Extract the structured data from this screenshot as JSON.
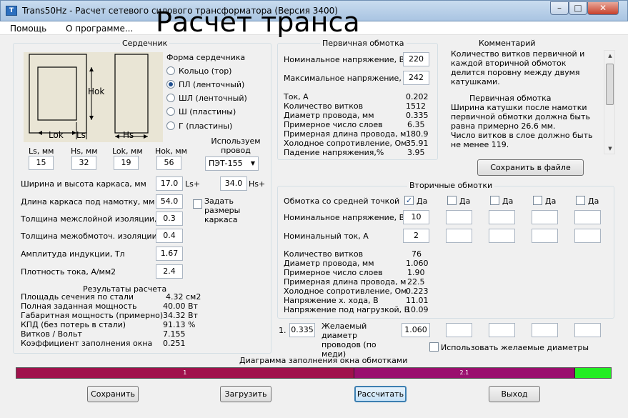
{
  "window": {
    "title": "Trans50Hz - Расчет сетевого силового трансформатора (Версия 3400)",
    "icon": "app-icon",
    "min": "–",
    "max": "□",
    "close": "✕"
  },
  "menu": {
    "help": "Помощь",
    "about": "О программе..."
  },
  "watermark": "Расчет транса",
  "core": {
    "title": "Сердечник",
    "figure_labels": {
      "hok": "Hok",
      "lok": "Lok",
      "ls": "Ls",
      "hs": "Hs"
    },
    "shape_title": "Форма сердечника",
    "shapes": [
      {
        "label": "Кольцо  (тор)",
        "selected": false
      },
      {
        "label": "ПЛ  (ленточный)",
        "selected": true
      },
      {
        "label": "ШЛ  (ленточный)",
        "selected": false
      },
      {
        "label": "Ш  (пластины)",
        "selected": false
      },
      {
        "label": "Г (пластины)",
        "selected": false
      }
    ],
    "dims": [
      {
        "label": "Ls, мм",
        "value": "15"
      },
      {
        "label": "Hs, мм",
        "value": "32"
      },
      {
        "label": "Lok, мм",
        "value": "19"
      },
      {
        "label": "Hok, мм",
        "value": "56"
      }
    ],
    "wire_label": "Используем провод",
    "wire_value": "ПЭТ-155",
    "frame_width_label": "Ширина и высота каркаса, мм",
    "frame_width": "17.0",
    "ls_plus": "Ls+",
    "frame_height": "34.0",
    "hs_plus": "Hs+",
    "frame_length_label": "Длина каркаса под намотку, мм",
    "frame_length": "54.0",
    "set_frame_label": "Задать размеры каркаса",
    "interlayer_label": "Толщина межслойной изоляции, мм",
    "interlayer": "0.3",
    "interwinding_label": "Толщина межобмоточ. изоляции, мм",
    "interwinding": "0.4",
    "induction_label": "Амплитуда индукции, Тл",
    "induction": "1.67",
    "current_density_label": "Плотность тока, А/мм2",
    "current_density": "2.4"
  },
  "results": {
    "title": "Результаты расчета",
    "rows": [
      {
        "label": "Площадь сечения по стали",
        "value": "4.32 см2"
      },
      {
        "label": "Полная заданная мощность",
        "value": "40.00 Вт"
      },
      {
        "label": "Габаритная мощность (примерно)",
        "value": "34.32 Вт"
      },
      {
        "label": "КПД (без потерь в стали)",
        "value": "91.13 %"
      },
      {
        "label": "Витков / Вольт",
        "value": "7.155"
      },
      {
        "label": "Коэффициент заполнения окна",
        "value": "0.251"
      }
    ]
  },
  "primary": {
    "title": "Первичная обмотка",
    "nominal_label": "Номинальное напряжение, В",
    "nominal": "220",
    "max_label": "Максимальное напряжение, В",
    "max": "242",
    "rows": [
      {
        "label": "Ток, А",
        "value": "0.202"
      },
      {
        "label": "Количество витков",
        "value": "1512"
      },
      {
        "label": "Диаметр провода, мм",
        "value": "0.335"
      },
      {
        "label": "Примерное число слоев",
        "value": "6.35"
      },
      {
        "label": "Примерная длина провода, м",
        "value": "180.9"
      },
      {
        "label": "Холодное сопротивление, Ом",
        "value": "35.91"
      },
      {
        "label": "Падение напряжения,%",
        "value": "3.95"
      }
    ]
  },
  "comment": {
    "title": "Комментарий",
    "text1": "Количество витков первичной и каждой вторичной обмоток делится поровну между двумя катушками.",
    "sub": "Первичная обмотка",
    "text2": "Ширина катушки после намотки первичной обмотки должна быть равна примерно 26.6 мм.",
    "text3": "Число витков в слое должно быть не менее 119.",
    "up": "▲",
    "down": "▼"
  },
  "save_file": "Сохранить в файле",
  "secondary": {
    "title": "Вторичные обмотки",
    "center_tap_label": "Обмотка со средней точкой",
    "yes": "Да",
    "nominal_label": "Номинальное напряжение, В",
    "current_label": "Номинальный ток, А",
    "cols": [
      {
        "checked": true,
        "voltage": "10",
        "current": "2",
        "desired": "1.060"
      },
      {
        "checked": false,
        "voltage": "",
        "current": "",
        "desired": ""
      },
      {
        "checked": false,
        "voltage": "",
        "current": "",
        "desired": ""
      },
      {
        "checked": false,
        "voltage": "",
        "current": "",
        "desired": ""
      },
      {
        "checked": false,
        "voltage": "",
        "current": "",
        "desired": ""
      }
    ],
    "rows": [
      {
        "label": "Количество витков",
        "value": "76"
      },
      {
        "label": "Диаметр провода, мм",
        "value": "1.060"
      },
      {
        "label": "Примерное число слоев",
        "value": "1.90"
      },
      {
        "label": "Примерная длина провода, м",
        "value": "22.5"
      },
      {
        "label": "Холодное сопротивление, Ом",
        "value": "0.223"
      },
      {
        "label": "Напряжение х. хода, В",
        "value": "11.01"
      },
      {
        "label": "Напряжение под нагрузкой, В",
        "value": "10.09"
      }
    ],
    "primary_index": "1.",
    "primary_desired": "0.335",
    "desired_label": "Желаемый диаметр проводов  (по меди)",
    "use_desired_label": "Использовать желаемые диаметры"
  },
  "diagram": {
    "title": "Диаграмма заполнения окна обмотками",
    "segments": [
      {
        "label": "1",
        "fraction": 0.568,
        "color": "#a0124c"
      },
      {
        "label": "2.1",
        "fraction": 0.372,
        "color": "#9a0f6e"
      },
      {
        "label": "",
        "fraction": 0.06,
        "color": "#22ee22"
      }
    ]
  },
  "buttons": {
    "save": "Сохранить",
    "load": "Загрузить",
    "calc": "Рассчитать",
    "exit": "Выход"
  }
}
